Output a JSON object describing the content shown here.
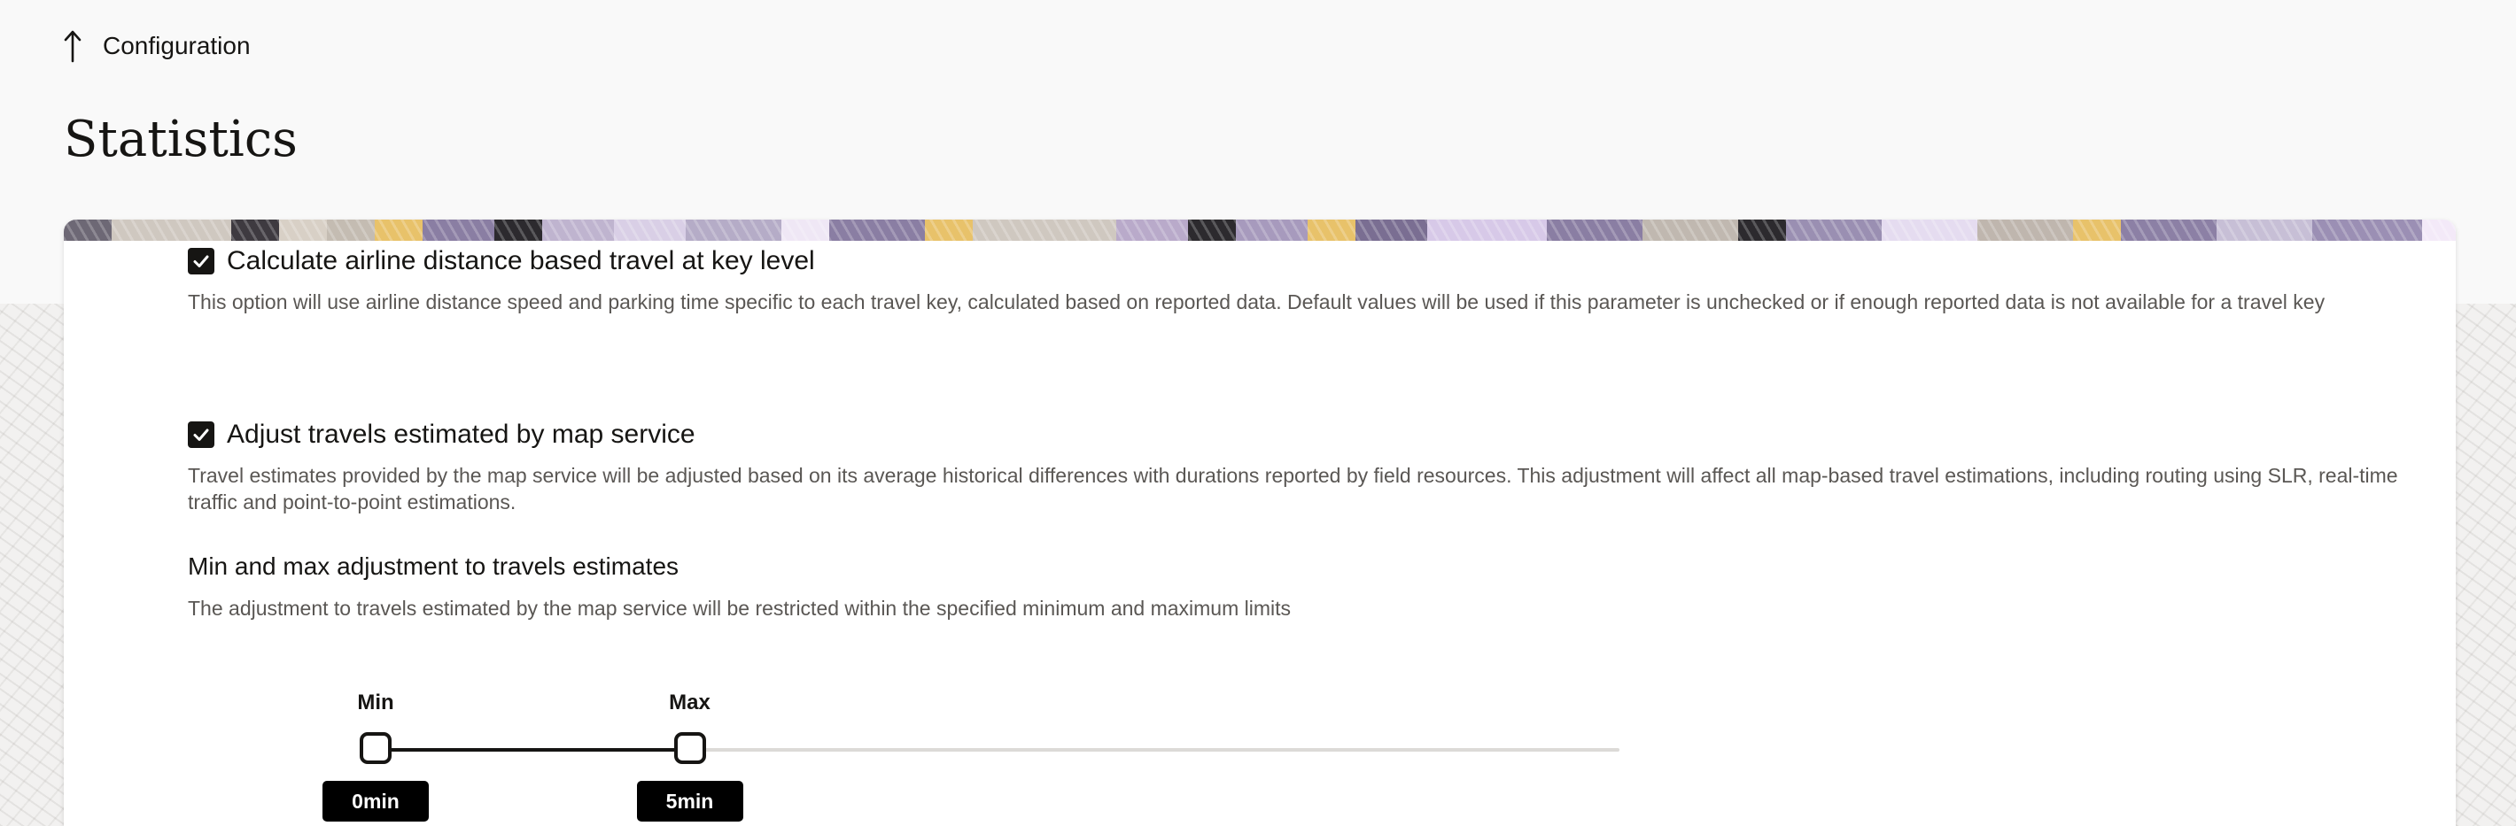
{
  "nav": {
    "back_label": "Configuration"
  },
  "page": {
    "title": "Statistics"
  },
  "settings": {
    "airline": {
      "checked": true,
      "label": "Calculate airline distance based travel at key level",
      "description": "This option will use airline distance speed and parking time specific to each travel key, calculated based on reported data. Default values will be used if this parameter is unchecked or if enough reported data is not available for a travel key"
    },
    "adjust": {
      "checked": true,
      "label": "Adjust travels estimated by map service",
      "description": "Travel estimates provided by the map service will be adjusted based on its average historical differences with durations reported by field resources. This adjustment will affect all map-based travel estimations, including routing using SLR, real-time traffic and point-to-point estimations."
    },
    "minmax": {
      "title": "Min and max adjustment to travels estimates",
      "description": "The adjustment to travels estimated by the map service will be restricted within the specified minimum and maximum limits",
      "min_label": "Min",
      "max_label": "Max",
      "min_value": "0min",
      "max_value": "5min",
      "min_fraction": 0.0,
      "max_fraction": 0.2525
    }
  },
  "colors": {
    "page_bg": "#f9f9f9",
    "card_bg": "#ffffff",
    "text": "#161513",
    "muted": "#5a5754",
    "checkbox": "#161513"
  }
}
